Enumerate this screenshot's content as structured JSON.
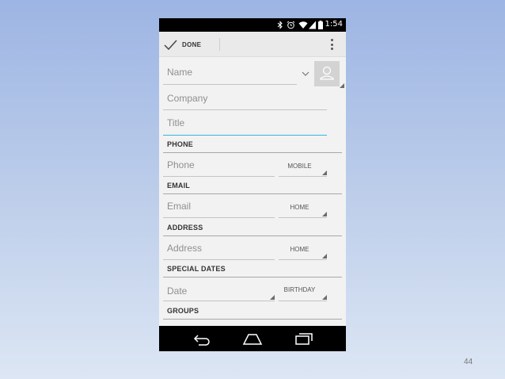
{
  "status_bar": {
    "time": "1:54"
  },
  "action_bar": {
    "done_label": "DONE"
  },
  "form": {
    "name_placeholder": "Name",
    "company_placeholder": "Company",
    "title_placeholder": "Title",
    "phone_section": "PHONE",
    "phone_placeholder": "Phone",
    "phone_type": "MOBILE",
    "email_section": "EMAIL",
    "email_placeholder": "Email",
    "email_type": "HOME",
    "address_section": "ADDRESS",
    "address_placeholder": "Address",
    "address_type": "HOME",
    "dates_section": "SPECIAL DATES",
    "date_placeholder": "Date",
    "date_type": "BIRTHDAY",
    "groups_section": "GROUPS"
  },
  "slide": {
    "page_number": "44"
  }
}
